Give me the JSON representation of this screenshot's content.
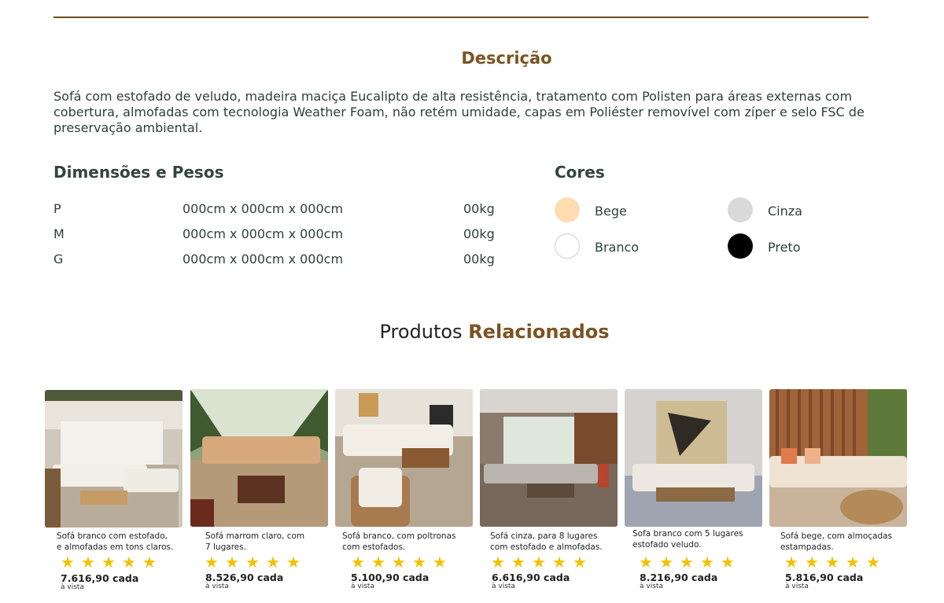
{
  "description": {
    "title": "Descrição",
    "text": "Sofá com estofado de veludo, madeira maciça Eucalipto de alta resistência, tratamento com Polisten para áreas externas com cobertura, almofadas com tecnologia Weather Foam, não retém umidade, capas em Poliéster removível com zíper e selo FSC de preservação ambiental."
  },
  "dimensions": {
    "title": "Dimensões e Pesos",
    "rows": [
      {
        "size": "P",
        "measure": "000cm x 000cm x 000cm",
        "weight": "00kg"
      },
      {
        "size": "M",
        "measure": "000cm x 000cm x 000cm",
        "weight": "00kg"
      },
      {
        "size": "G",
        "measure": "000cm x 000cm x 000cm",
        "weight": "00kg"
      }
    ]
  },
  "colors": {
    "title": "Cores",
    "items": [
      {
        "name": "Bege",
        "hex": "#fddcb1"
      },
      {
        "name": "Cinza",
        "hex": "#d9d9d9"
      },
      {
        "name": "Branco",
        "hex": "#ffffff"
      },
      {
        "name": "Preto",
        "hex": "#000000"
      }
    ]
  },
  "related": {
    "title_plain": "Produtos",
    "title_accent": "Relacionados",
    "products": [
      {
        "name_line1": "Sofá branco com estofado,",
        "name_line2": "e almofadas em tons claros.",
        "rating": 5,
        "price": "7.616,90 cada",
        "price_note": "à vista"
      },
      {
        "name_line1": "Sofá marrom claro, com",
        "name_line2": "7 lugares.",
        "rating": 5,
        "price": "8.526,90 cada",
        "price_note": "à vista"
      },
      {
        "name_line1": "Sofá branco, com poltronas",
        "name_line2": "com estofados.",
        "rating": 5,
        "price": "5.100,90 cada",
        "price_note": "à vista"
      },
      {
        "name_line1": "Sofá cinza, para 8 lugares",
        "name_line2": "com estofado e almofadas.",
        "rating": 5,
        "price": "6.616,90 cada",
        "price_note": "à vista"
      },
      {
        "name_line1": "Sofa branco com 5 lugares",
        "name_line2": "estofado veludo.",
        "rating": 5,
        "price": "8.216,90 cada",
        "price_note": "à vista"
      },
      {
        "name_line1": "Sofá bege, com almoçadas",
        "name_line2": "estampadas.",
        "rating": 5,
        "price": "5.816,90 cada",
        "price_note": "à vista"
      }
    ]
  }
}
